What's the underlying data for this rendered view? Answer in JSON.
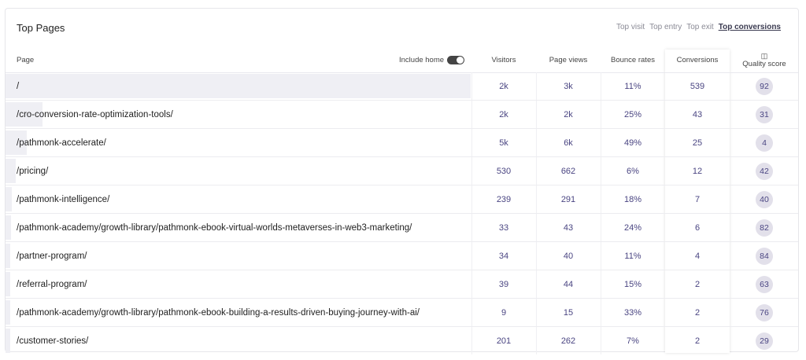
{
  "title": "Top Pages",
  "filters": [
    {
      "label": "Top visit",
      "active": false
    },
    {
      "label": "Top entry",
      "active": false
    },
    {
      "label": "Top exit",
      "active": false
    },
    {
      "label": "Top conversions",
      "active": true
    }
  ],
  "include_home": {
    "label": "Include home",
    "on": true
  },
  "columns": {
    "page": "Page",
    "visitors": "Visitors",
    "page_views": "Page views",
    "bounce": "Bounce rates",
    "conversions": "Conversions",
    "quality": "Quality score",
    "quality_icon": "robot-icon"
  },
  "rows": [
    {
      "page": "/",
      "visitors": "2k",
      "page_views": "3k",
      "bounce": "11%",
      "conversions": "539",
      "quality": "92"
    },
    {
      "page": "/cro-conversion-rate-optimization-tools/",
      "visitors": "2k",
      "page_views": "2k",
      "bounce": "25%",
      "conversions": "43",
      "quality": "31"
    },
    {
      "page": "/pathmonk-accelerate/",
      "visitors": "5k",
      "page_views": "6k",
      "bounce": "49%",
      "conversions": "25",
      "quality": "4"
    },
    {
      "page": "/pricing/",
      "visitors": "530",
      "page_views": "662",
      "bounce": "6%",
      "conversions": "12",
      "quality": "42"
    },
    {
      "page": "/pathmonk-intelligence/",
      "visitors": "239",
      "page_views": "291",
      "bounce": "18%",
      "conversions": "7",
      "quality": "40"
    },
    {
      "page": "/pathmonk-academy/growth-library/pathmonk-ebook-virtual-worlds-metaverses-in-web3-marketing/",
      "visitors": "33",
      "page_views": "43",
      "bounce": "24%",
      "conversions": "6",
      "quality": "82"
    },
    {
      "page": "/partner-program/",
      "visitors": "34",
      "page_views": "40",
      "bounce": "11%",
      "conversions": "4",
      "quality": "84"
    },
    {
      "page": "/referral-program/",
      "visitors": "39",
      "page_views": "44",
      "bounce": "15%",
      "conversions": "2",
      "quality": "63"
    },
    {
      "page": "/pathmonk-academy/growth-library/pathmonk-ebook-building-a-results-driven-buying-journey-with-ai/",
      "visitors": "9",
      "page_views": "15",
      "bounce": "33%",
      "conversions": "2",
      "quality": "76"
    },
    {
      "page": "/customer-stories/",
      "visitors": "201",
      "page_views": "262",
      "bounce": "7%",
      "conversions": "2",
      "quality": "29"
    }
  ]
}
